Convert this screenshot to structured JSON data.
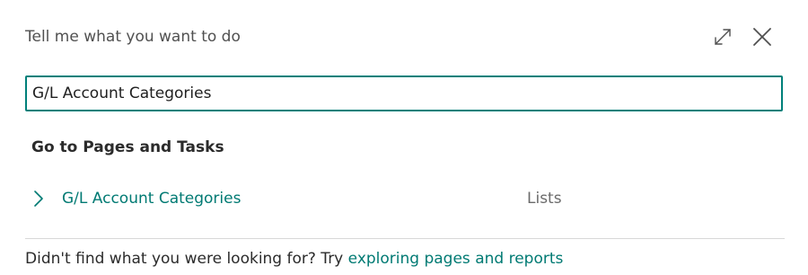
{
  "dialog": {
    "title": "Tell me what you want to do",
    "expand_icon": "expand-arrows-icon",
    "close_icon": "close-x-icon"
  },
  "search": {
    "value": "G/L Account Categories",
    "placeholder": ""
  },
  "results": {
    "section_heading": "Go to Pages and Tasks",
    "items": [
      {
        "label": "G/L Account Categories",
        "category": "Lists",
        "icon": "chevron-right-icon"
      }
    ]
  },
  "footer": {
    "prefix": "Didn't find what you were looking for? Try",
    "link_text": "exploring pages and reports"
  },
  "colors": {
    "accent": "#00807a",
    "link": "#007a73",
    "divider": "#d8d8d8"
  }
}
